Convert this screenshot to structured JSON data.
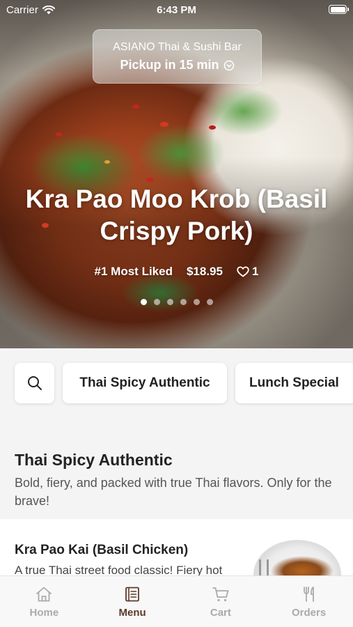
{
  "status_bar": {
    "carrier": "Carrier",
    "time": "6:43 PM"
  },
  "store": {
    "name": "ASIANO Thai & Sushi Bar",
    "pickup": "Pickup in 15 min"
  },
  "hero": {
    "title": "Kra Pao Moo Krob (Basil Crispy Pork)",
    "badge": "#1 Most Liked",
    "price": "$18.95",
    "likes": "1",
    "page_count": 6,
    "active_page": 1
  },
  "chips": {
    "items": [
      {
        "label": "Thai Spicy Authentic"
      },
      {
        "label": "Lunch Special"
      }
    ]
  },
  "section": {
    "title": "Thai Spicy Authentic",
    "description": "Bold, fiery, and packed with true Thai flavors. Only for the brave!"
  },
  "item": {
    "name": "Kra Pao Kai (Basil Chicken)",
    "description": "A true Thai street food classic! Fiery hot"
  },
  "tabs": [
    {
      "label": "Home",
      "icon": "home-icon"
    },
    {
      "label": "Menu",
      "icon": "menu-icon",
      "active": true
    },
    {
      "label": "Cart",
      "icon": "cart-icon"
    },
    {
      "label": "Orders",
      "icon": "utensils-icon"
    }
  ],
  "colors": {
    "accent": "#5c3a2a",
    "inactive_tab": "#aaaaaa",
    "background": "#f4f4f4"
  }
}
